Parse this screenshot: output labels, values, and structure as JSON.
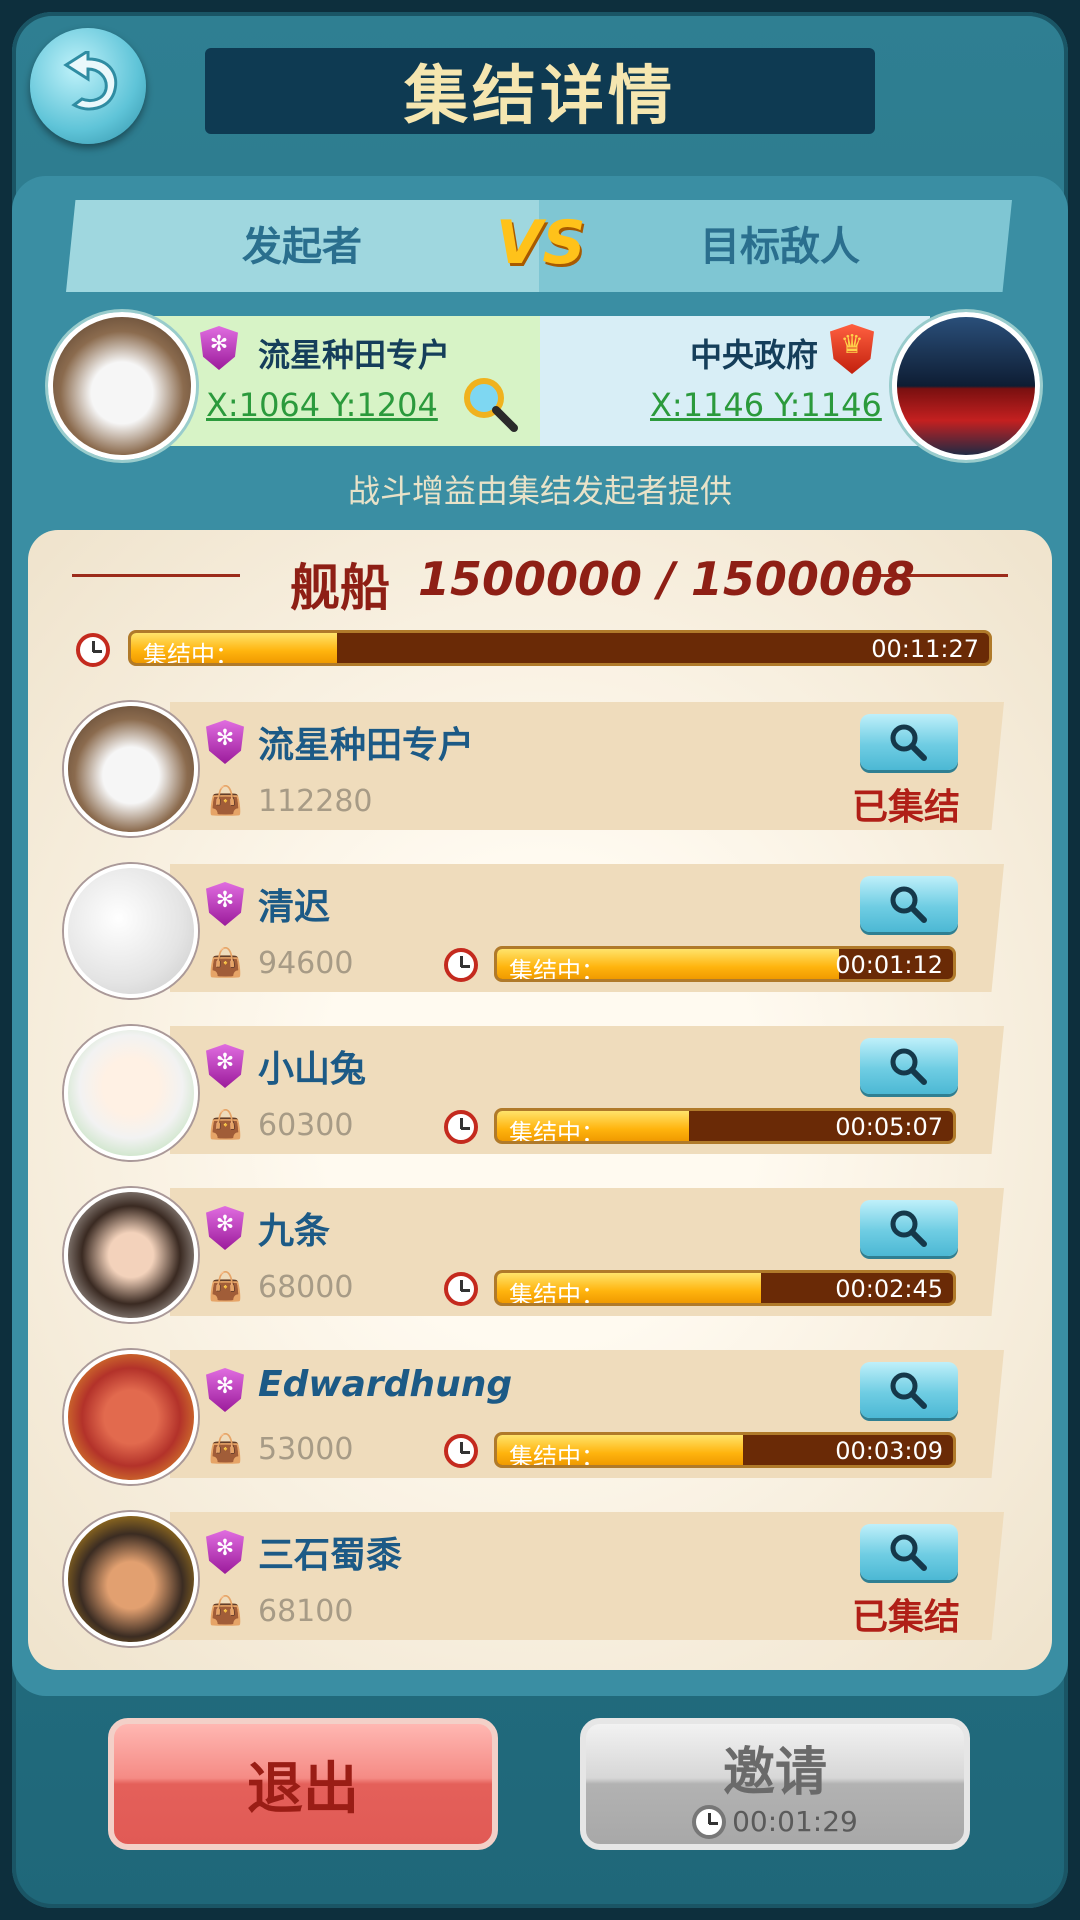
{
  "header": {
    "title": "集结详情"
  },
  "versus": {
    "initiator_label": "发起者",
    "vs_text": "VS",
    "target_label": "目标敌人",
    "initiator": {
      "name": "流星种田专户",
      "coords": "X:1064 Y:1204"
    },
    "target": {
      "name": "中央政府",
      "coords": "X:1146 Y:1146"
    },
    "note": "战斗增益由集结发起者提供"
  },
  "ships": {
    "label": "舰船",
    "value": "1500000 / 1500008",
    "timer_label": "集结中：",
    "timer_time": "00:11:27",
    "progress": 0.24
  },
  "members": [
    {
      "name": "流星种田专户",
      "count": "112280",
      "status": "已集结",
      "latin": false
    },
    {
      "name": "清迟",
      "count": "94600",
      "timer_label": "集结中：",
      "time": "00:01:12",
      "progress": 0.75,
      "latin": false
    },
    {
      "name": "小山兔",
      "count": "60300",
      "timer_label": "集结中：",
      "time": "00:05:07",
      "progress": 0.42,
      "latin": false
    },
    {
      "name": "九条",
      "count": "68000",
      "timer_label": "集结中：",
      "time": "00:02:45",
      "progress": 0.58,
      "latin": false
    },
    {
      "name": "Edwardhung",
      "count": "53000",
      "timer_label": "集结中：",
      "time": "00:03:09",
      "progress": 0.54,
      "latin": true
    },
    {
      "name": "三石蜀黍",
      "count": "68100",
      "status": "已集结",
      "latin": false
    }
  ],
  "buttons": {
    "exit_label": "退出",
    "invite_label": "邀请",
    "invite_time": "00:01:29"
  },
  "icons": {
    "back": "back-arrow-icon",
    "search": "magnifier-icon",
    "clock": "clock-icon",
    "shield": "alliance-shield-icon",
    "crown": "crown-shield-icon",
    "bag": "supply-bag-icon"
  },
  "colors": {
    "accent_red": "#b01f17",
    "name_blue": "#1c5a86",
    "progress_yellow": "#ffb40e"
  }
}
